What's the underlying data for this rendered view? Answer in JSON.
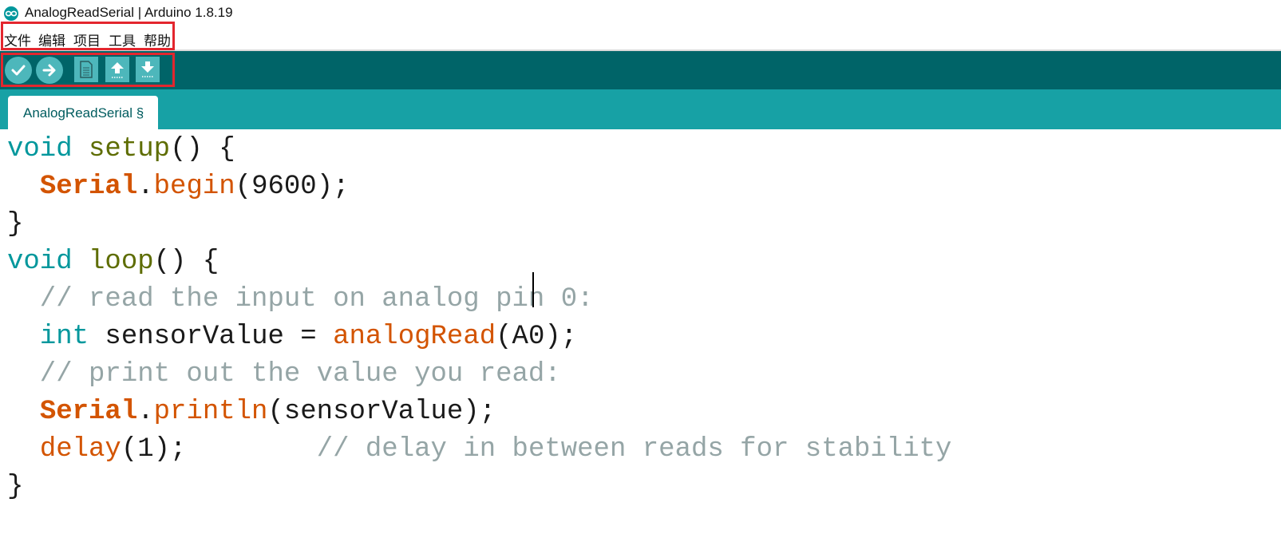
{
  "window": {
    "title": "AnalogReadSerial | Arduino 1.8.19",
    "icon": "arduino-infinity-icon"
  },
  "menu": {
    "items": [
      "文件",
      "编辑",
      "项目",
      "工具",
      "帮助"
    ]
  },
  "toolbar": {
    "buttons": [
      {
        "name": "verify",
        "icon": "checkmark-icon"
      },
      {
        "name": "upload",
        "icon": "arrow-right-icon"
      },
      {
        "name": "new",
        "icon": "document-icon"
      },
      {
        "name": "open",
        "icon": "arrow-up-icon"
      },
      {
        "name": "save",
        "icon": "arrow-down-icon"
      }
    ]
  },
  "tabs": [
    {
      "label": "AnalogReadSerial §"
    }
  ],
  "editor": {
    "line1": {
      "t1": "void",
      "t2": " ",
      "t3": "setup",
      "t4": "() {"
    },
    "line2": {
      "t1": "  ",
      "t2": "Serial",
      "t3": ".",
      "t4": "begin",
      "t5": "(9600);"
    },
    "line3": {
      "t1": "}"
    },
    "line4": {
      "t1": "void",
      "t2": " ",
      "t3": "loop",
      "t4": "() {"
    },
    "line5": {
      "t1": "  // read the input on analog pin 0:"
    },
    "line6": {
      "t1": "  ",
      "t2": "int",
      "t3": " sensorValue = ",
      "t4": "analogRead",
      "t5": "(A0);"
    },
    "line7": {
      "t1": "  // print out the value you read:"
    },
    "line8": {
      "t1": "  ",
      "t2": "Serial",
      "t3": ".",
      "t4": "println",
      "t5": "(sensorValue);"
    },
    "line9": {
      "t1": "  ",
      "t2": "delay",
      "t3": "(1);",
      "t4": "        // delay in between reads for stability"
    },
    "line10": {
      "t1": "}"
    }
  },
  "colors": {
    "toolbar_bg": "#006468",
    "tabstrip_bg": "#17a1a5",
    "button_bg": "#4db7bb",
    "highlight_box": "#e3262e",
    "type_keyword": "#00979c",
    "function_keyword": "#5e6d03",
    "library_keyword": "#d35400",
    "comment": "#95a5a6"
  }
}
